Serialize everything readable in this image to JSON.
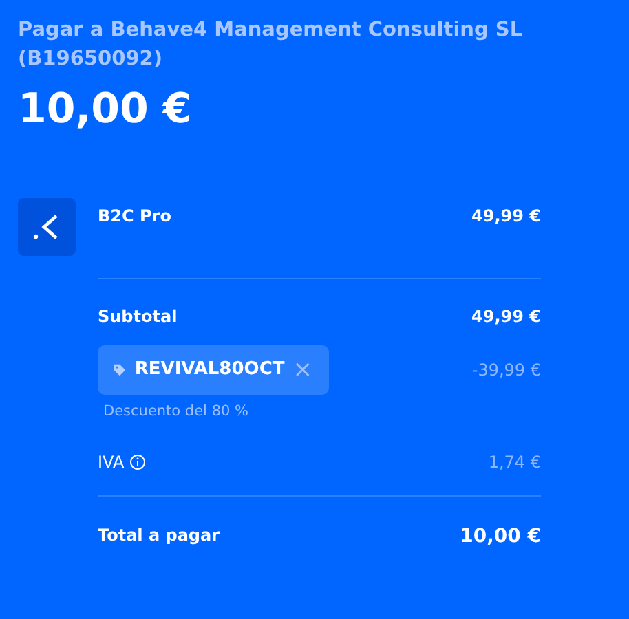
{
  "header": {
    "payee": "Pagar a Behave4 Management Consulting SL (B19650092)",
    "amount": "10,00 €"
  },
  "product": {
    "name": "B2C Pro",
    "price": "49,99 €"
  },
  "subtotal": {
    "label": "Subtotal",
    "value": "49,99 €"
  },
  "coupon": {
    "code": "REVIVAL80OCT",
    "remove": "×",
    "discount": "-39,99 €",
    "description": "Descuento del 80 %"
  },
  "tax": {
    "label": "IVA",
    "value": "1,74 €"
  },
  "total": {
    "label": "Total a pagar",
    "value": "10,00 €"
  }
}
